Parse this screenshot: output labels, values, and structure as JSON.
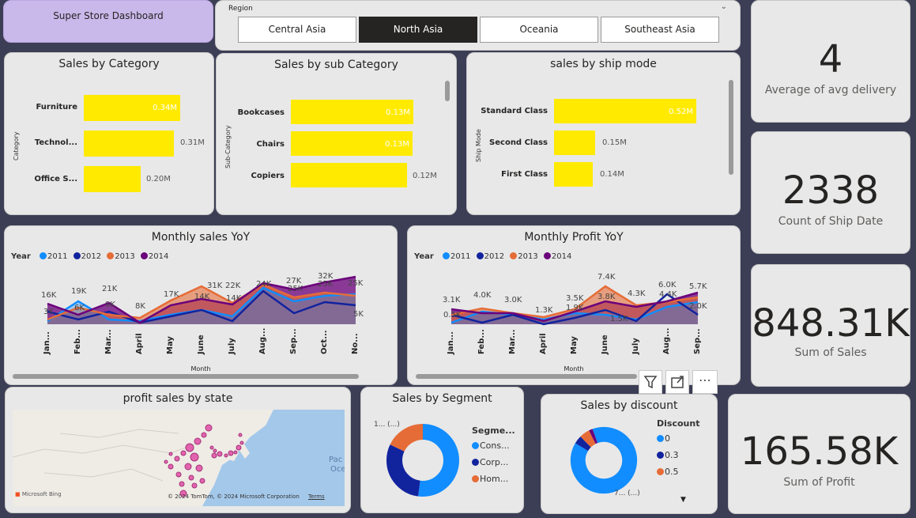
{
  "header": {
    "title": "Super Store Dashboard"
  },
  "slicer": {
    "label": "Region",
    "options": [
      "Central Asia",
      "North Asia",
      "Oceania",
      "Southeast Asia"
    ],
    "selected": "North Asia"
  },
  "kpis": {
    "avg_delivery": {
      "value": "4",
      "label": "Average of avg delivery"
    },
    "ship_count": {
      "value": "2338",
      "label": "Count of Ship Date"
    },
    "sales": {
      "value": "848.31K",
      "label": "Sum of Sales"
    },
    "profit": {
      "value": "165.58K",
      "label": "Sum of Profit"
    }
  },
  "sales_by_category": {
    "title": "Sales by Category",
    "axis_title": "Category",
    "items": [
      {
        "label": "Furniture",
        "value": 0.34,
        "text": "0.34M"
      },
      {
        "label": "Technol...",
        "value": 0.31,
        "text": "0.31M"
      },
      {
        "label": "Office S...",
        "value": 0.2,
        "text": "0.20M"
      }
    ]
  },
  "sales_by_sub_category": {
    "title": "Sales by sub Category",
    "axis_title": "Sub-Category",
    "items": [
      {
        "label": "Bookcases",
        "value": 0.13,
        "text": "0.13M"
      },
      {
        "label": "Chairs",
        "value": 0.13,
        "text": "0.13M"
      },
      {
        "label": "Copiers",
        "value": 0.12,
        "text": "0.12M"
      }
    ]
  },
  "sales_by_ship_mode": {
    "title": "sales by ship mode",
    "axis_title": "Ship Mode",
    "items": [
      {
        "label": "Standard Class",
        "value": 0.52,
        "text": "0.52M"
      },
      {
        "label": "Second Class",
        "value": 0.15,
        "text": "0.15M"
      },
      {
        "label": "First Class",
        "value": 0.14,
        "text": "0.14M"
      }
    ]
  },
  "monthly_sales": {
    "title": "Monthly sales YoY",
    "legend_title": "Year",
    "xlabel": "Month",
    "months": [
      "Jan...",
      "Feb...",
      "Mar...",
      "April",
      "May",
      "June",
      "July",
      "Aug...",
      "Sep...",
      "Oct...",
      "No..."
    ],
    "labels": [
      "16K",
      "19K",
      "21K",
      "8K",
      "17K",
      "31K",
      "22K",
      "24K",
      "27K",
      "32K",
      "25K",
      "14K",
      "6K",
      "9K",
      "3K",
      "14K",
      "25K",
      "25K",
      "5K"
    ]
  },
  "monthly_profit": {
    "title": "Monthly Profit YoY",
    "legend_title": "Year",
    "xlabel": "Month",
    "months": [
      "Jan...",
      "Feb...",
      "Mar...",
      "April",
      "May",
      "June",
      "July",
      "Aug...",
      "Sep..."
    ],
    "labels": [
      "3.1K",
      "4.0K",
      "3.0K",
      "1.3K",
      "3.5K",
      "7.4K",
      "4.3K",
      "6.0K",
      "5.7K",
      "3.8K",
      "4.4K",
      "2.0K",
      "0.5K",
      "1.9K",
      "1.5K"
    ]
  },
  "years": [
    {
      "name": "2011",
      "color": "#118dff"
    },
    {
      "name": "2012",
      "color": "#12239e"
    },
    {
      "name": "2013",
      "color": "#e66c37"
    },
    {
      "name": "2014",
      "color": "#6b007b"
    }
  ],
  "map": {
    "title": "profit sales by state",
    "ocean_label_1": "Pac",
    "ocean_label_2": "Oce",
    "credit": "© 2024 TomTom, © 2024 Microsoft Corporation",
    "terms": "Terms",
    "brand": "Microsoft Bing"
  },
  "segment": {
    "title": "Sales by Segment",
    "legend_title": "Segme...",
    "slice_label": "1... (...)",
    "items": [
      {
        "label": "Cons...",
        "color": "#118dff",
        "value": 0.52
      },
      {
        "label": "Corp...",
        "color": "#12239e",
        "value": 0.3
      },
      {
        "label": "Hom...",
        "color": "#e66c37",
        "value": 0.18
      }
    ]
  },
  "discount": {
    "title": "Sales by discount",
    "legend_title": "Discount",
    "slice_label": "7... (...)",
    "items": [
      {
        "label": "0",
        "color": "#118dff",
        "value": 0.89
      },
      {
        "label": "0.3",
        "color": "#12239e",
        "value": 0.04
      },
      {
        "label": "0.5",
        "color": "#e66c37",
        "value": 0.05
      }
    ],
    "other_color": "#6b007b",
    "other_value": 0.02
  }
}
